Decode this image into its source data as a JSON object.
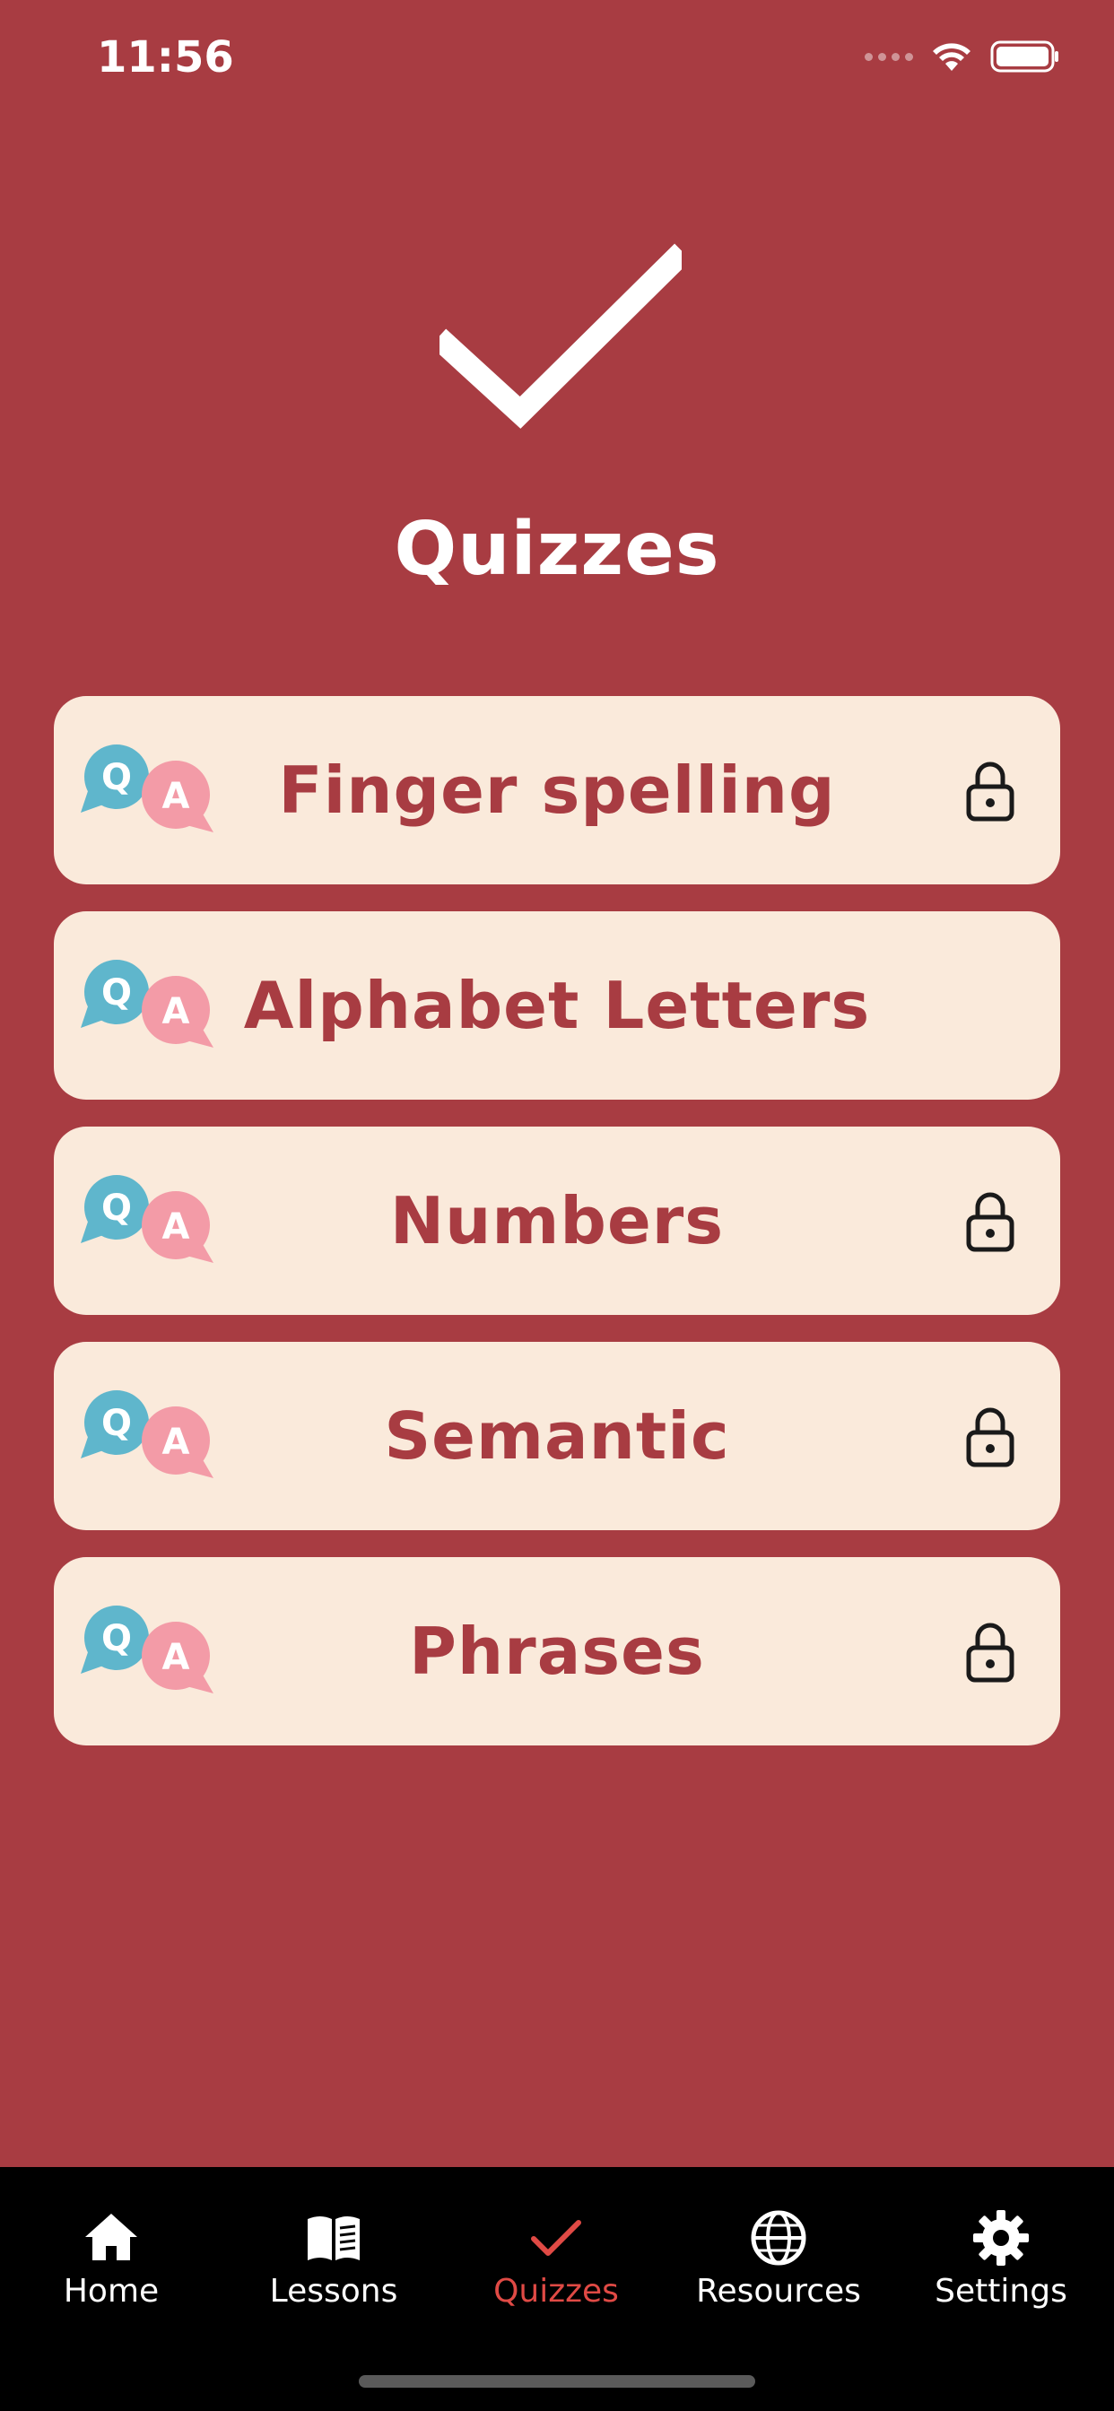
{
  "status_bar": {
    "time": "11:56"
  },
  "header": {
    "title": "Quizzes",
    "icon": "checkmark-icon"
  },
  "quizzes": [
    {
      "label": "Finger spelling",
      "locked": true
    },
    {
      "label": "Alphabet Letters",
      "locked": false
    },
    {
      "label": "Numbers",
      "locked": true
    },
    {
      "label": "Semantic",
      "locked": true
    },
    {
      "label": "Phrases",
      "locked": true
    }
  ],
  "tab_bar": {
    "items": [
      {
        "label": "Home",
        "icon": "home-icon",
        "active": false
      },
      {
        "label": "Lessons",
        "icon": "book-icon",
        "active": false
      },
      {
        "label": "Quizzes",
        "icon": "checkmark-icon",
        "active": true
      },
      {
        "label": "Resources",
        "icon": "globe-icon",
        "active": false
      },
      {
        "label": "Settings",
        "icon": "gear-icon",
        "active": false
      }
    ]
  },
  "colors": {
    "background": "#a83c42",
    "card": "#faeadb",
    "card_text": "#a83c42",
    "tab_active": "#e04a45",
    "tab_bar": "#000000"
  }
}
